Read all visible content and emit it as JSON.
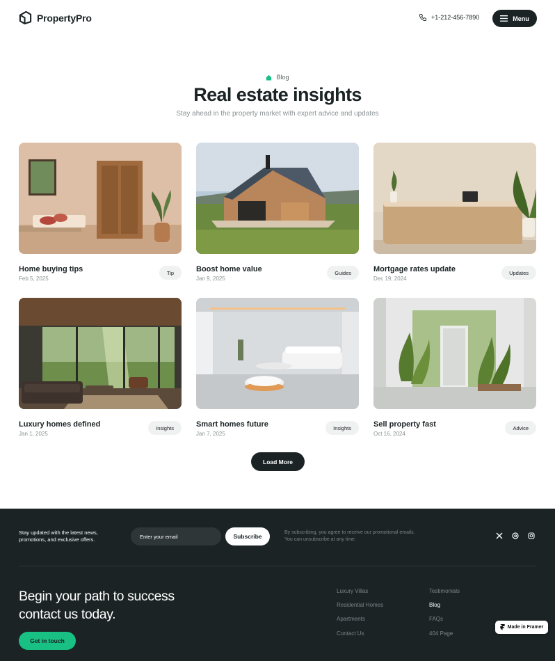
{
  "header": {
    "brand": "PropertyPro",
    "phone": "+1-212-456-7890",
    "menu_label": "Menu"
  },
  "hero": {
    "eyebrow": "Blog",
    "title": "Real estate insights",
    "subtitle": "Stay ahead in the property market with expert advice and updates"
  },
  "posts": [
    {
      "title": "Home buying tips",
      "date": "Feb 5, 2025",
      "tag": "Tip"
    },
    {
      "title": "Boost home value",
      "date": "Jan 9, 2025",
      "tag": "Guides"
    },
    {
      "title": "Mortgage rates update",
      "date": "Dec 19, 2024",
      "tag": "Updates"
    },
    {
      "title": "Luxury homes defined",
      "date": "Jan 1, 2025",
      "tag": "Insights"
    },
    {
      "title": "Smart homes future",
      "date": "Jan 7, 2025",
      "tag": "Insights"
    },
    {
      "title": "Sell property fast",
      "date": "Oct 16, 2024",
      "tag": "Advice"
    }
  ],
  "load_more_label": "Load More",
  "footer": {
    "newsletter_text": "Stay updated with the latest news, promotions, and exclusive offers.",
    "email_placeholder": "Enter your email",
    "subscribe_label": "Subscribe",
    "legal": "By subscribing, you agree to receive our promotional emails. You can unsubscribe  at any time.",
    "social_icons": [
      "x-icon",
      "threads-icon",
      "instagram-icon"
    ],
    "cta_line1": "Begin your path to  success",
    "cta_line2": "contact us today.",
    "cta_button": "Get in touch",
    "links_col1": [
      "Luxury Villas",
      "Residential Homes",
      "Apartments",
      "Contact Us"
    ],
    "links_col2": [
      "Testimonials",
      "Blog",
      "FAQs",
      "404 Page"
    ],
    "active_link": "Blog",
    "badge": "Made in Framer"
  },
  "colors": {
    "dark": "#1b2325",
    "accent": "#19c084",
    "muted": "#8a9294"
  }
}
